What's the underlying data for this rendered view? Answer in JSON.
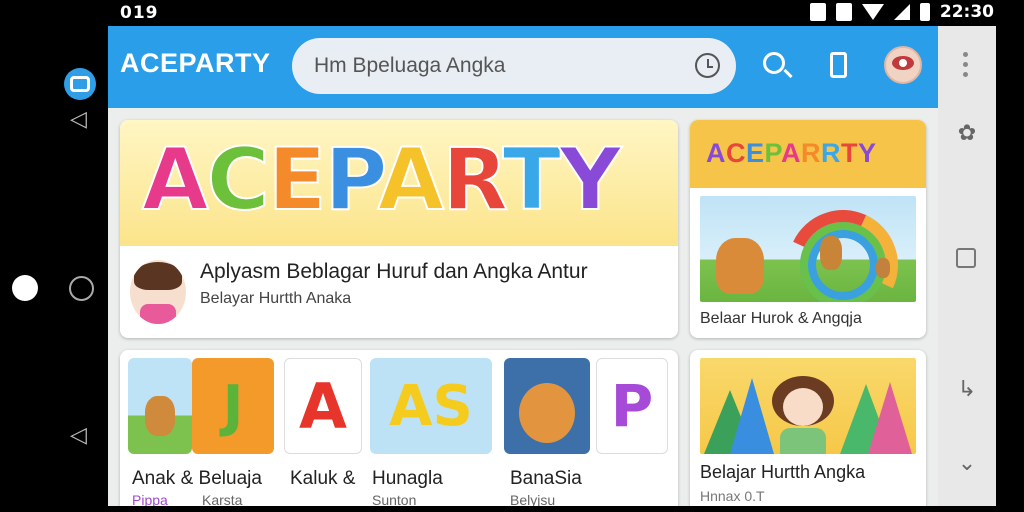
{
  "status_bar": {
    "left_text": "019",
    "time": "22:30"
  },
  "app": {
    "brand": "ACEPARTY"
  },
  "search": {
    "text": "Hm Bpeluaga Angka"
  },
  "hero": {
    "logo": [
      "A",
      "C",
      "E",
      "P",
      "A",
      "R",
      "T",
      "Y"
    ],
    "logo_colors": [
      "#e83a8a",
      "#6cc03a",
      "#f48a2a",
      "#3a8fe0",
      "#f6c22a",
      "#e8463a",
      "#3aa8e8",
      "#8a4ad8"
    ],
    "title": "Aplyasm Beblagar Huruf dan Angka Antur",
    "subtitle": "Belayar Hurtth Anaka"
  },
  "side_card_1": {
    "logo": "ACEPARRTY",
    "caption": "Belaar Hurok & Angqja"
  },
  "tiles": [
    {
      "glyph": "",
      "label": "Anak & Beluaja",
      "sub": "Pippa"
    },
    {
      "glyph": "J",
      "label": "",
      "sub": "Karsta"
    },
    {
      "glyph": "A",
      "label": "Kaluk &",
      "sub": ""
    },
    {
      "glyph": "AS",
      "label": "Hunagla",
      "sub": "Sunton"
    },
    {
      "glyph": "",
      "label": "BanaSia",
      "sub": "Belyjsu"
    },
    {
      "glyph": "P",
      "label": "",
      "sub": ""
    }
  ],
  "side_card_2": {
    "caption": "Belajar Hurtth Angka",
    "sub": "Hnnax 0.T"
  }
}
